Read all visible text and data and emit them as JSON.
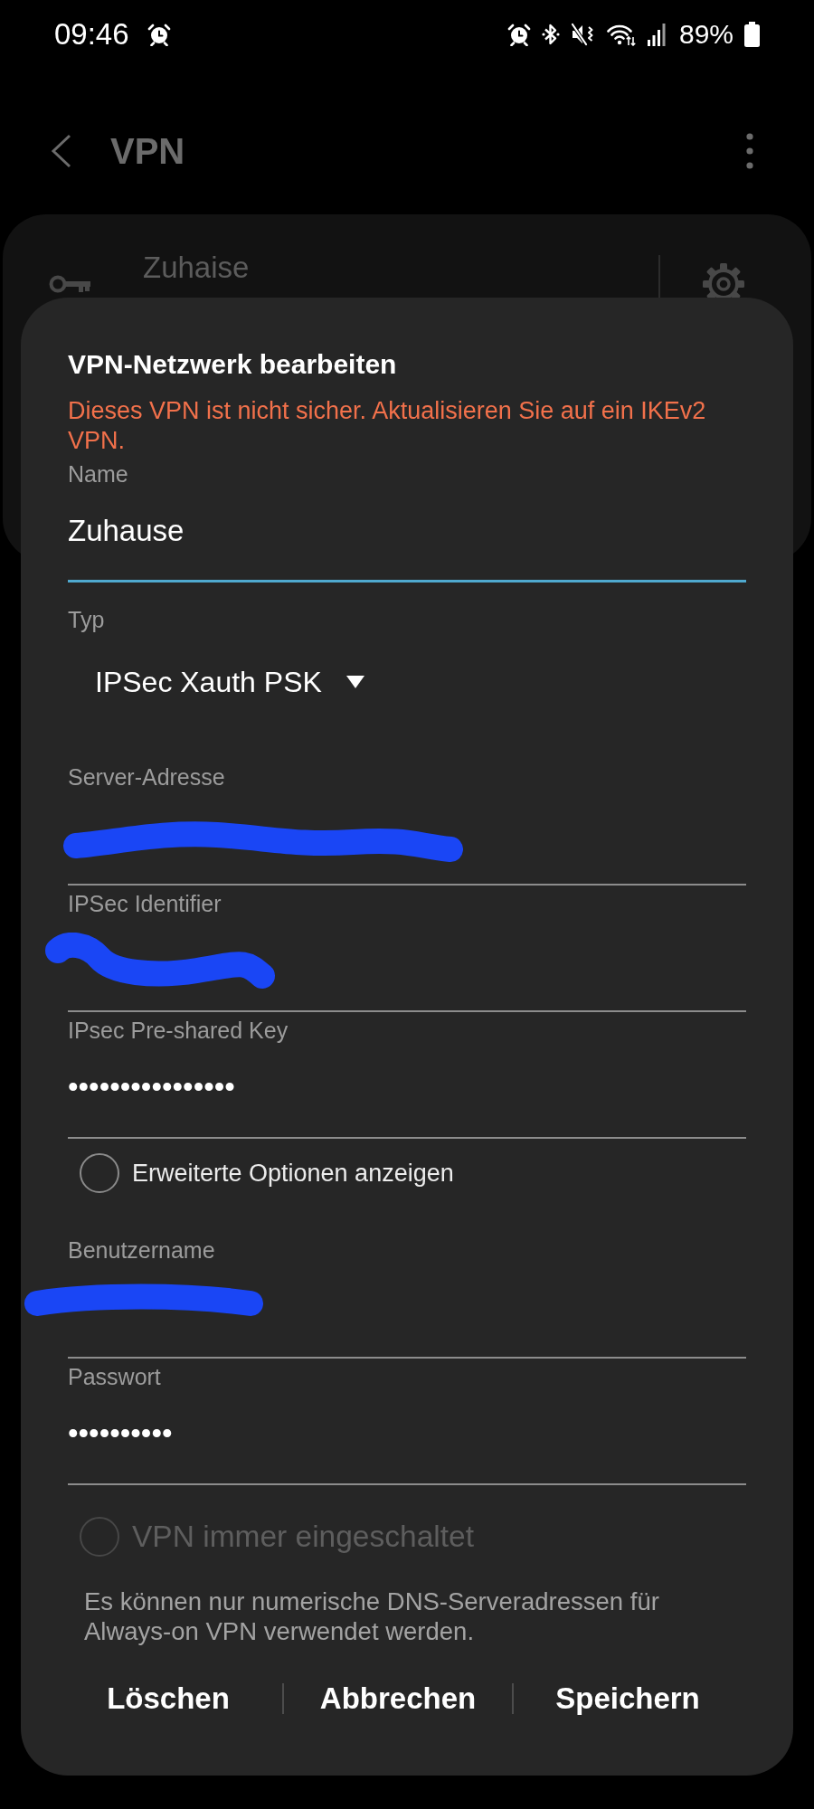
{
  "status_bar": {
    "time": "09:46",
    "battery": "89%"
  },
  "app_bar": {
    "title": "VPN"
  },
  "vpn_list": [
    {
      "name": "Zuhaise"
    }
  ],
  "dialog": {
    "title": "VPN-Netzwerk bearbeiten",
    "warning": "Dieses VPN ist nicht sicher. Aktualisieren Sie auf ein IKEv2 VPN.",
    "fields": [
      {
        "kind": "text",
        "label": "Name",
        "value": "Zuhause",
        "focused": true,
        "redacted": false
      },
      {
        "kind": "dropdown",
        "label": "Typ",
        "value": "IPSec Xauth PSK"
      },
      {
        "kind": "text",
        "label": "Server-Adresse",
        "focused": false,
        "redacted": true
      },
      {
        "kind": "text",
        "label": "IPSec Identifier",
        "focused": false,
        "redacted": true
      },
      {
        "kind": "password",
        "label": "IPsec Pre-shared Key",
        "value": "••••••••••••••••",
        "focused": false,
        "redacted": false
      },
      {
        "kind": "radio",
        "label": "Erweiterte Optionen anzeigen",
        "checked": false,
        "disabled": false
      },
      {
        "kind": "text",
        "label": "Benutzername",
        "focused": false,
        "redacted": true
      },
      {
        "kind": "password",
        "label": "Passwort",
        "value": "••••••••••",
        "focused": false,
        "redacted": false
      },
      {
        "kind": "radio",
        "label": "VPN immer eingeschaltet",
        "checked": false,
        "disabled": true
      },
      {
        "kind": "note",
        "text": "Es können nur numerische DNS-Serveradressen für Always-on VPN verwendet werden."
      }
    ],
    "buttons": [
      "Löschen",
      "Abbrechen",
      "Speichern"
    ]
  }
}
